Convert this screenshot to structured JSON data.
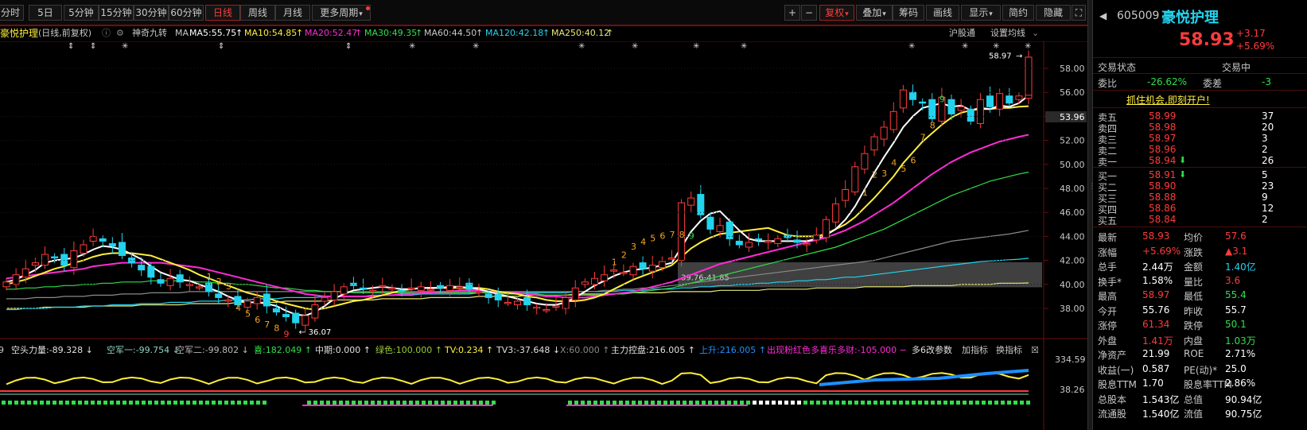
{
  "toolbar": {
    "periods": [
      "分时",
      "5日",
      "5分钟",
      "15分钟",
      "30分钟",
      "60分钟",
      "日线",
      "周线",
      "月线",
      "更多周期"
    ],
    "active": "日线",
    "right": [
      "+",
      "−",
      "复权",
      "叠加",
      "筹码",
      "画线",
      "显示",
      "简约",
      "隐藏"
    ]
  },
  "info": {
    "stock_name": "豪悦护理",
    "mode": "(日线,前复权)",
    "indicator": "神奇九转",
    "ma_label": "MA",
    "ma5": "MA5:55.75",
    "ma10": "MA10:54.85",
    "ma20": "MA20:52.47",
    "ma30": "MA30:49.35",
    "ma60": "MA60:44.50",
    "ma120": "MA120:42.18",
    "ma250": "MA250:40.12",
    "hgt": "沪股通",
    "set_ma": "设置均线"
  },
  "colors": {
    "up": "#ff3b3b",
    "down": "#22d3ee",
    "ma5": "#ffffff",
    "ma10": "#ffef3a",
    "ma20": "#ff2bd6",
    "ma30": "#2fe04a",
    "ma60": "#8a8a8a",
    "ma120": "#22d3ee",
    "ma250": "#e8e878"
  },
  "chart_data": {
    "type": "candlestick",
    "y_ticks": [
      "58.00",
      "56.00",
      "54.00",
      "52.00",
      "50.00",
      "48.00",
      "46.00",
      "44.00",
      "42.00",
      "40.00",
      "38.00"
    ],
    "ylim": [
      36,
      60
    ],
    "current_price_tag": "53.96",
    "high_label": "58.97",
    "low_label": "36.07",
    "zone_label": "39.76-41.85",
    "nine_turn_labels": [
      "1",
      "2",
      "3",
      "4",
      "5",
      "6",
      "7",
      "8",
      "9",
      "1",
      "2",
      "3",
      "4",
      "5",
      "6",
      "7",
      "8",
      "9",
      "1",
      "2",
      "3",
      "4",
      "5",
      "6",
      "7",
      "8",
      "9"
    ],
    "closes": [
      40.2,
      40.8,
      41.3,
      41.8,
      42.5,
      42.2,
      41.6,
      42.8,
      43.3,
      44.0,
      43.6,
      43.2,
      42.4,
      41.8,
      41.2,
      40.6,
      40.1,
      40.5,
      40.2,
      40.0,
      39.8,
      39.4,
      38.9,
      38.7,
      38.3,
      38.6,
      38.9,
      38.2,
      37.7,
      37.3,
      36.8,
      37.4,
      38.3,
      38.9,
      39.4,
      39.8,
      39.9,
      39.6,
      39.5,
      39.9,
      39.7,
      39.4,
      39.7,
      39.8,
      39.6,
      39.7,
      39.9,
      39.8,
      39.6,
      39.4,
      38.9,
      38.7,
      38.5,
      38.6,
      38.3,
      38.1,
      37.9,
      38.2,
      38.9,
      39.7,
      40.2,
      40.5,
      40.8,
      41.2,
      41.0,
      41.5,
      41.3,
      41.6,
      41.9,
      42.2,
      46.8,
      47.2,
      45.8,
      44.6,
      44.9,
      43.8,
      43.3,
      43.5,
      43.7,
      43.6,
      43.8,
      43.9,
      43.5,
      43.4,
      44.1,
      45.4,
      46.7,
      47.9,
      49.8,
      50.9,
      52.3,
      53.1,
      54.4,
      56.2,
      55.4,
      55.1,
      53.8,
      55.6,
      54.2,
      54.8,
      53.6,
      55.4,
      54.8,
      55.9,
      55.1,
      55.7,
      58.93
    ],
    "ma5": [
      40.2,
      40.4,
      40.8,
      41.2,
      41.8,
      42.0,
      42.1,
      42.2,
      42.5,
      42.9,
      43.2,
      43.1,
      42.9,
      42.5,
      42.1,
      41.5,
      41.0,
      40.7,
      40.4,
      40.3,
      40.0,
      39.7,
      39.4,
      39.0,
      38.7,
      38.5,
      38.5,
      38.4,
      38.2,
      37.8,
      37.5,
      37.4,
      37.7,
      38.2,
      38.8,
      39.2,
      39.5,
      39.6,
      39.7,
      39.8,
      39.7,
      39.6,
      39.6,
      39.7,
      39.7,
      39.7,
      39.8,
      39.8,
      39.7,
      39.6,
      39.4,
      39.2,
      39.0,
      38.8,
      38.6,
      38.4,
      38.3,
      38.3,
      38.5,
      38.9,
      39.4,
      39.9,
      40.3,
      40.7,
      41.0,
      41.2,
      41.3,
      41.4,
      41.6,
      41.8,
      43.1,
      44.4,
      45.3,
      45.9,
      46.1,
      45.3,
      44.5,
      43.8,
      43.6,
      43.6,
      43.6,
      43.6,
      43.6,
      43.6,
      43.8,
      44.1,
      44.6,
      45.4,
      46.5,
      47.9,
      49.3,
      50.6,
      51.8,
      53.1,
      54.0,
      54.7,
      54.9,
      55.1,
      54.8,
      54.9,
      54.5,
      54.7,
      54.6,
      54.9,
      54.8,
      55.1,
      55.75
    ],
    "ma10": [
      40.0,
      40.2,
      40.4,
      40.7,
      41.0,
      41.3,
      41.5,
      41.8,
      42.0,
      42.3,
      42.5,
      42.6,
      42.6,
      42.6,
      42.5,
      42.4,
      42.1,
      41.8,
      41.5,
      41.2,
      40.8,
      40.5,
      40.2,
      39.9,
      39.6,
      39.3,
      39.1,
      38.9,
      38.6,
      38.4,
      38.2,
      38.0,
      37.9,
      38.0,
      38.2,
      38.4,
      38.6,
      38.7,
      38.9,
      39.1,
      39.3,
      39.5,
      39.6,
      39.7,
      39.7,
      39.7,
      39.7,
      39.7,
      39.7,
      39.7,
      39.6,
      39.4,
      39.3,
      39.2,
      39.0,
      38.9,
      38.7,
      38.6,
      38.6,
      38.6,
      38.7,
      38.9,
      39.2,
      39.6,
      40.0,
      40.4,
      40.7,
      41.0,
      41.3,
      41.6,
      42.3,
      43.0,
      43.5,
      43.9,
      44.2,
      44.3,
      44.4,
      44.5,
      44.6,
      44.7,
      44.4,
      44.1,
      44.0,
      44.0,
      44.0,
      44.2,
      44.6,
      45.0,
      45.6,
      46.4,
      47.2,
      48.1,
      49.0,
      50.1,
      51.0,
      51.9,
      52.6,
      53.3,
      53.9,
      54.3,
      54.5,
      54.6,
      54.6,
      54.7,
      54.7,
      54.8,
      54.85
    ],
    "ma20": [
      40.5,
      40.6,
      40.7,
      40.8,
      40.9,
      41.0,
      41.1,
      41.2,
      41.3,
      41.5,
      41.6,
      41.7,
      41.8,
      41.8,
      41.8,
      41.8,
      41.8,
      41.7,
      41.6,
      41.5,
      41.4,
      41.2,
      41.0,
      40.8,
      40.6,
      40.4,
      40.2,
      40.0,
      39.8,
      39.6,
      39.4,
      39.2,
      39.1,
      39.0,
      39.0,
      39.0,
      39.0,
      39.0,
      39.0,
      39.1,
      39.1,
      39.2,
      39.2,
      39.3,
      39.3,
      39.4,
      39.4,
      39.5,
      39.5,
      39.5,
      39.4,
      39.4,
      39.3,
      39.3,
      39.2,
      39.1,
      39.0,
      39.0,
      38.9,
      38.9,
      38.9,
      39.0,
      39.1,
      39.2,
      39.3,
      39.4,
      39.6,
      39.8,
      40.0,
      40.2,
      40.5,
      40.8,
      41.1,
      41.4,
      41.7,
      41.9,
      42.1,
      42.3,
      42.5,
      42.7,
      42.9,
      43.1,
      43.3,
      43.5,
      43.7,
      43.9,
      44.2,
      44.5,
      44.9,
      45.3,
      45.8,
      46.3,
      46.8,
      47.4,
      48.0,
      48.6,
      49.2,
      49.7,
      50.2,
      50.6,
      51.0,
      51.3,
      51.6,
      51.9,
      52.1,
      52.3,
      52.47
    ],
    "ma30": [
      39.6,
      39.6,
      39.7,
      39.7,
      39.8,
      39.8,
      39.9,
      39.9,
      40.0,
      40.0,
      40.1,
      40.1,
      40.2,
      40.2,
      40.2,
      40.3,
      40.3,
      40.3,
      40.3,
      40.3,
      40.2,
      40.2,
      40.1,
      40.1,
      40.0,
      40.0,
      39.9,
      39.8,
      39.7,
      39.7,
      39.6,
      39.5,
      39.5,
      39.4,
      39.4,
      39.4,
      39.3,
      39.3,
      39.3,
      39.3,
      39.3,
      39.3,
      39.3,
      39.3,
      39.3,
      39.3,
      39.3,
      39.3,
      39.3,
      39.3,
      39.3,
      39.3,
      39.2,
      39.2,
      39.2,
      39.2,
      39.1,
      39.1,
      39.1,
      39.1,
      39.1,
      39.1,
      39.1,
      39.2,
      39.2,
      39.3,
      39.4,
      39.5,
      39.6,
      39.7,
      39.9,
      40.1,
      40.3,
      40.5,
      40.7,
      40.9,
      41.1,
      41.3,
      41.5,
      41.7,
      41.9,
      42.1,
      42.3,
      42.5,
      42.7,
      42.9,
      43.1,
      43.4,
      43.7,
      44.0,
      44.3,
      44.6,
      45.0,
      45.4,
      45.8,
      46.2,
      46.6,
      47.0,
      47.4,
      47.7,
      48.0,
      48.3,
      48.6,
      48.8,
      49.0,
      49.2,
      49.35
    ],
    "ma60": [
      38.8,
      38.8,
      38.8,
      38.9,
      38.9,
      38.9,
      39.0,
      39.0,
      39.0,
      39.1,
      39.1,
      39.1,
      39.2,
      39.2,
      39.2,
      39.3,
      39.3,
      39.3,
      39.3,
      39.4,
      39.4,
      39.4,
      39.4,
      39.4,
      39.4,
      39.4,
      39.4,
      39.4,
      39.4,
      39.4,
      39.4,
      39.4,
      39.4,
      39.4,
      39.4,
      39.4,
      39.4,
      39.4,
      39.4,
      39.4,
      39.4,
      39.4,
      39.4,
      39.4,
      39.4,
      39.4,
      39.4,
      39.4,
      39.4,
      39.4,
      39.4,
      39.4,
      39.4,
      39.4,
      39.4,
      39.4,
      39.4,
      39.4,
      39.4,
      39.4,
      39.4,
      39.4,
      39.5,
      39.5,
      39.6,
      39.6,
      39.7,
      39.7,
      39.8,
      39.9,
      40.0,
      40.1,
      40.2,
      40.3,
      40.4,
      40.5,
      40.6,
      40.7,
      40.8,
      40.9,
      41.0,
      41.1,
      41.2,
      41.3,
      41.4,
      41.5,
      41.6,
      41.7,
      41.8,
      41.9,
      42.0,
      42.2,
      42.4,
      42.6,
      42.8,
      43.0,
      43.2,
      43.4,
      43.6,
      43.7,
      43.8,
      43.9,
      44.0,
      44.1,
      44.2,
      44.35,
      44.5
    ],
    "ma120": [
      37.9,
      37.9,
      38.0,
      38.0,
      38.0,
      38.1,
      38.1,
      38.1,
      38.2,
      38.2,
      38.2,
      38.3,
      38.3,
      38.3,
      38.4,
      38.4,
      38.4,
      38.5,
      38.5,
      38.5,
      38.6,
      38.6,
      38.6,
      38.7,
      38.7,
      38.7,
      38.8,
      38.8,
      38.8,
      38.9,
      38.9,
      38.9,
      38.9,
      39.0,
      39.0,
      39.0,
      39.0,
      39.0,
      39.1,
      39.1,
      39.1,
      39.1,
      39.1,
      39.2,
      39.2,
      39.2,
      39.2,
      39.2,
      39.2,
      39.3,
      39.3,
      39.3,
      39.3,
      39.3,
      39.3,
      39.3,
      39.3,
      39.3,
      39.3,
      39.4,
      39.4,
      39.4,
      39.4,
      39.4,
      39.5,
      39.5,
      39.5,
      39.6,
      39.6,
      39.6,
      39.7,
      39.7,
      39.8,
      39.8,
      39.9,
      39.9,
      40.0,
      40.0,
      40.1,
      40.1,
      40.2,
      40.2,
      40.3,
      40.3,
      40.4,
      40.4,
      40.5,
      40.6,
      40.6,
      40.7,
      40.8,
      40.9,
      41.0,
      41.1,
      41.2,
      41.3,
      41.4,
      41.5,
      41.6,
      41.7,
      41.8,
      41.9,
      41.95,
      42.0,
      42.05,
      42.1,
      42.18
    ],
    "ma250": [
      38.0,
      38.0,
      38.0,
      38.0,
      38.1,
      38.1,
      38.1,
      38.1,
      38.1,
      38.2,
      38.2,
      38.2,
      38.2,
      38.2,
      38.3,
      38.3,
      38.3,
      38.3,
      38.3,
      38.4,
      38.4,
      38.4,
      38.4,
      38.4,
      38.5,
      38.5,
      38.5,
      38.5,
      38.5,
      38.6,
      38.6,
      38.6,
      38.6,
      38.6,
      38.7,
      38.7,
      38.7,
      38.7,
      38.7,
      38.8,
      38.8,
      38.8,
      38.8,
      38.8,
      38.9,
      38.9,
      38.9,
      38.9,
      38.9,
      39.0,
      39.0,
      39.0,
      39.0,
      39.0,
      39.1,
      39.1,
      39.1,
      39.1,
      39.1,
      39.2,
      39.2,
      39.2,
      39.2,
      39.2,
      39.3,
      39.3,
      39.3,
      39.3,
      39.3,
      39.4,
      39.4,
      39.4,
      39.4,
      39.4,
      39.5,
      39.5,
      39.5,
      39.5,
      39.5,
      39.6,
      39.6,
      39.6,
      39.6,
      39.6,
      39.7,
      39.7,
      39.7,
      39.7,
      39.7,
      39.8,
      39.8,
      39.8,
      39.8,
      39.8,
      39.9,
      39.9,
      39.9,
      39.9,
      39.9,
      40.0,
      40.0,
      40.0,
      40.0,
      40.1,
      40.1,
      40.1,
      40.12
    ]
  },
  "sub": {
    "items": [
      {
        "t": "空头力量:-89.328 ↓",
        "c": "#e0e0e0"
      },
      {
        "t": "空军一:-99.754 ↓",
        "c": "#8fd3c0"
      },
      {
        "t": "空军二:-99.802 ↓",
        "c": "#b8b8b8"
      },
      {
        "t": "喜:182.049 ↑",
        "c": "#2fe04a"
      },
      {
        "t": "中期:0.000 ↑",
        "c": "#e0e0e0"
      },
      {
        "t": "绿色:100.000 ↑",
        "c": "#9acd32"
      },
      {
        "t": "TV:0.234 ↑",
        "c": "#ffef3a"
      },
      {
        "t": "TV3:-37.648 ↓",
        "c": "#e0e0e0"
      },
      {
        "t": "X:60.000 ↑",
        "c": "#8a8a8a"
      },
      {
        "t": "主力控盘:216.005 ↑",
        "c": "#e0e0e0"
      },
      {
        "t": "上升:216.005 ↑",
        "c": "#1e90ff"
      },
      {
        "t": "出现粉红色多喜乐多财:-105.000 −",
        "c": "#ff2bd6"
      },
      {
        "t": "多6改参数",
        "c": "#e0e0e0"
      },
      {
        "t": "加指标",
        "c": "#c8c8c8"
      },
      {
        "t": "换指标",
        "c": "#c8c8c8"
      }
    ],
    "y_ticks": [
      "334.59",
      "38.26"
    ],
    "left_digit": "9"
  },
  "panel": {
    "code": "605009",
    "name": "豪悦护理",
    "price": "58.93",
    "change": "+3.17",
    "pct": "+5.69%",
    "status_label": "交易状态",
    "status_label2": "交易中",
    "weibi_label": "委比",
    "weibi": "-26.62%",
    "weicha_label": "委差",
    "weicha": "-3",
    "banner": "抓住机会,即刻开户!",
    "sell": [
      {
        "l": "卖五",
        "p": "58.99",
        "v": "37"
      },
      {
        "l": "卖四",
        "p": "58.98",
        "v": "20"
      },
      {
        "l": "卖三",
        "p": "58.97",
        "v": "3"
      },
      {
        "l": "卖二",
        "p": "58.96",
        "v": "2"
      },
      {
        "l": "卖一",
        "p": "58.94",
        "v": "26"
      }
    ],
    "buy": [
      {
        "l": "买一",
        "p": "58.91",
        "v": "5"
      },
      {
        "l": "买二",
        "p": "58.90",
        "v": "23"
      },
      {
        "l": "买三",
        "p": "58.88",
        "v": "9"
      },
      {
        "l": "买四",
        "p": "58.86",
        "v": "12"
      },
      {
        "l": "买五",
        "p": "58.84",
        "v": "2"
      }
    ],
    "stats": [
      [
        "最新",
        "58.93",
        "red",
        "均价",
        "57.6",
        "red"
      ],
      [
        "涨幅",
        "+5.69%",
        "red",
        "涨跌",
        "▲3.1",
        "red"
      ],
      [
        "总手",
        "2.44万",
        "wht",
        "金额",
        "1.40亿",
        "cyn"
      ],
      [
        "换手*",
        "1.58%",
        "wht",
        "量比",
        "3.6",
        "red"
      ],
      [
        "最高",
        "58.97",
        "red",
        "最低",
        "55.4",
        "grn"
      ],
      [
        "今开",
        "55.76",
        "wht",
        "昨收",
        "55.7",
        "wht"
      ],
      [
        "涨停",
        "61.34",
        "red",
        "跌停",
        "50.1",
        "grn"
      ],
      [
        "外盘",
        "1.41万",
        "red",
        "内盘",
        "1.03万",
        "grn"
      ],
      [
        "净资产",
        "21.99",
        "wht",
        "ROE",
        "2.71%",
        "wht"
      ],
      [
        "收益(一)",
        "0.587",
        "wht",
        "PE(动)*",
        "25.0",
        "wht"
      ],
      [
        "股息TTM",
        "1.70",
        "wht",
        "股息率TTM",
        "2.86%",
        "wht"
      ],
      [
        "总股本",
        "1.543亿",
        "wht",
        "总值",
        "90.94亿",
        "wht"
      ],
      [
        "流通股",
        "1.540亿",
        "wht",
        "流值",
        "90.75亿",
        "wht"
      ]
    ]
  }
}
